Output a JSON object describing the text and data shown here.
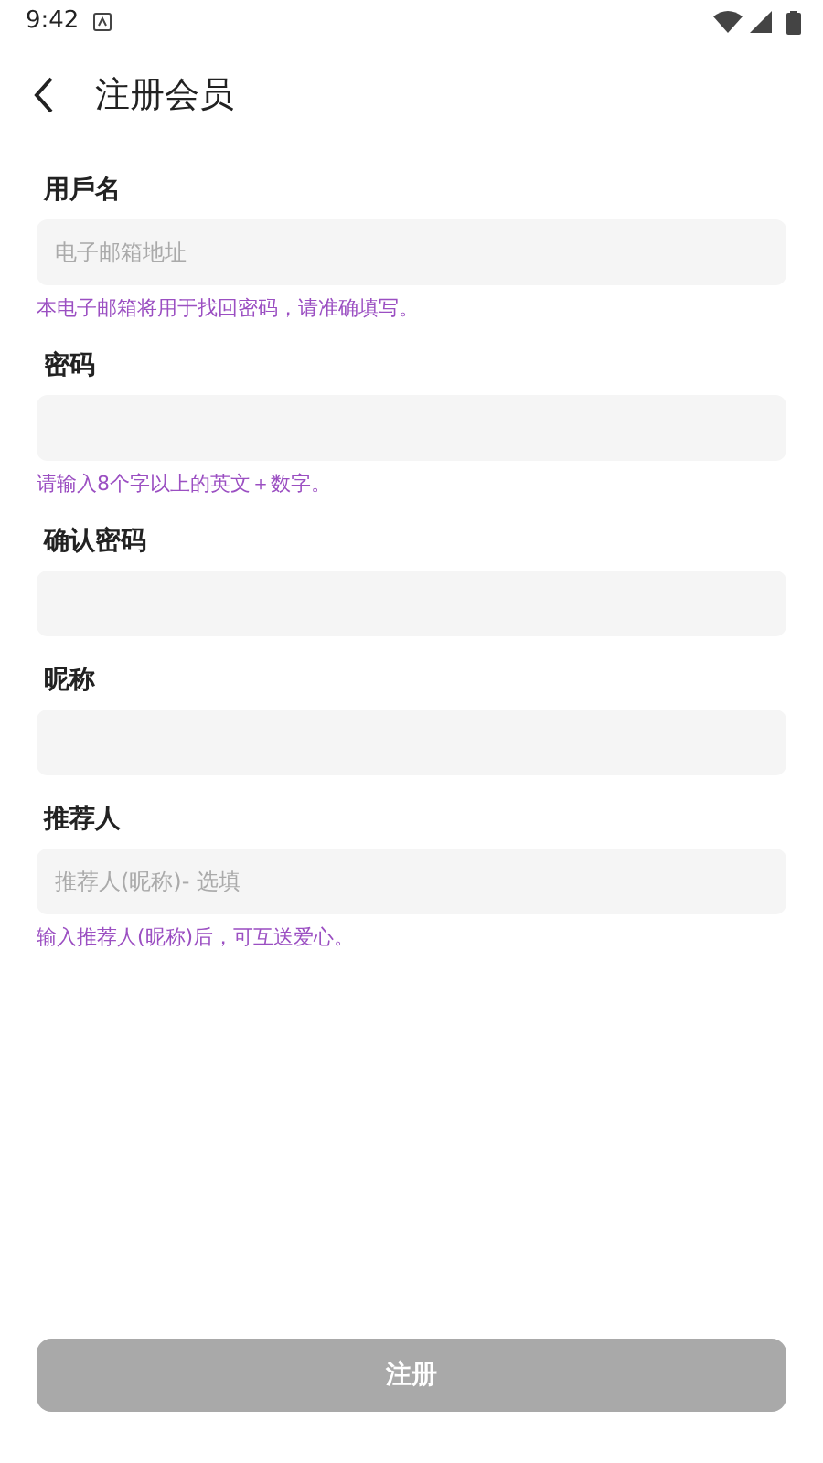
{
  "status_bar": {
    "time": "9:42"
  },
  "header": {
    "title": "注册会员"
  },
  "fields": [
    {
      "label": "用戶名",
      "placeholder": "电子邮箱地址",
      "hint": "本电子邮箱将用于找回密码，请准确填写。"
    },
    {
      "label": "密码",
      "hint": "请输入8个字以上的英文＋数字。"
    },
    {
      "label": "确认密码"
    },
    {
      "label": "昵称"
    },
    {
      "label": "推荐人",
      "placeholder": "推荐人(昵称)- 选填",
      "hint": "输入推荐人(昵称)后，可互送爱心。"
    }
  ],
  "submit": {
    "label": "注册",
    "disabled": true
  }
}
